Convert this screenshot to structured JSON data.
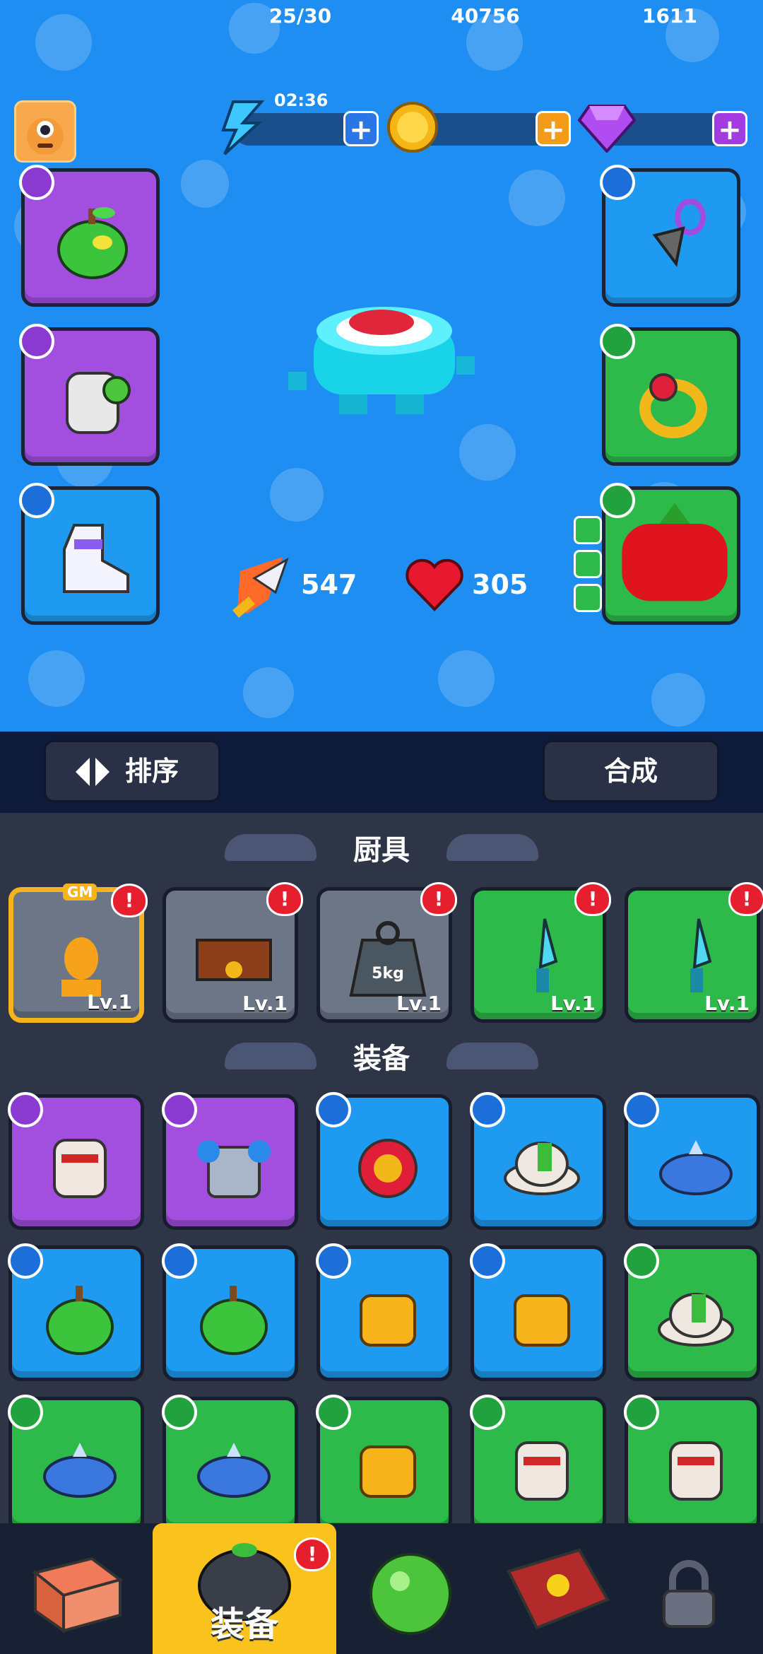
{
  "header": {
    "energy": "25/30",
    "energy_timer": "02:36",
    "coins": "40756",
    "gems": "1611",
    "plus": "+"
  },
  "hero": {
    "attack": "547",
    "health": "305"
  },
  "equipped_slots": [
    {
      "name": "helmet",
      "color": "purple",
      "item": "green-apple-helmet-icon"
    },
    {
      "name": "armor",
      "color": "purple",
      "item": "grey-armor-icon"
    },
    {
      "name": "boots",
      "color": "blue",
      "item": "boots-icon"
    },
    {
      "name": "necklace",
      "color": "blue",
      "item": "pendant-icon"
    },
    {
      "name": "ring",
      "color": "green",
      "item": "ruby-ring-icon"
    },
    {
      "name": "pet",
      "color": "green",
      "item": "tomato-pet-icon"
    }
  ],
  "toolbar": {
    "sort_label": "排序",
    "merge_label": "合成"
  },
  "sections": {
    "kitchenware": "厨具",
    "equipment": "装备"
  },
  "kitchenware": [
    {
      "item": "golden-statue-icon",
      "level": "Lv.1",
      "rarity": "gold",
      "tag": "GM"
    },
    {
      "item": "chest-icon",
      "level": "Lv.1",
      "rarity": "gray"
    },
    {
      "item": "weight-icon",
      "level": "Lv.1",
      "rarity": "gray",
      "weight_label": "5kg"
    },
    {
      "item": "knife-icon",
      "level": "Lv.1",
      "rarity": "green"
    },
    {
      "item": "knife-icon",
      "level": "Lv.1",
      "rarity": "green"
    }
  ],
  "equipment": [
    {
      "item": "chef-armor-icon",
      "rarity": "purple",
      "slot": "armor"
    },
    {
      "item": "barrel-armor-icon",
      "rarity": "purple",
      "slot": "armor"
    },
    {
      "item": "crown-helmet-icon",
      "rarity": "blue",
      "slot": "helmet"
    },
    {
      "item": "green-cap-icon",
      "rarity": "blue",
      "slot": "helmet"
    },
    {
      "item": "spiked-helmet-icon",
      "rarity": "blue",
      "slot": "helmet"
    },
    {
      "item": "apple-helmet-icon",
      "rarity": "blue",
      "slot": "helmet"
    },
    {
      "item": "apple-helmet-icon",
      "rarity": "blue",
      "slot": "helmet"
    },
    {
      "item": "gold-armor-icon",
      "rarity": "blue",
      "slot": "armor"
    },
    {
      "item": "gold-armor-icon",
      "rarity": "blue",
      "slot": "armor"
    },
    {
      "item": "green-cap-icon",
      "rarity": "green",
      "slot": "helmet"
    },
    {
      "item": "spiked-helmet-icon",
      "rarity": "green",
      "slot": "helmet"
    },
    {
      "item": "spiked-helmet-icon",
      "rarity": "green",
      "slot": "helmet"
    },
    {
      "item": "gold-armor-icon",
      "rarity": "green",
      "slot": "armor"
    },
    {
      "item": "chef-armor-icon",
      "rarity": "green",
      "slot": "armor"
    },
    {
      "item": "chef-armor-icon",
      "rarity": "green",
      "slot": "armor"
    }
  ],
  "nav": {
    "tabs": [
      {
        "name": "shop",
        "icon": "shop-box-icon",
        "label": ""
      },
      {
        "name": "equipment",
        "icon": "helmet-icon",
        "label": "装备",
        "active": true
      },
      {
        "name": "skills",
        "icon": "green-orb-icon",
        "label": ""
      },
      {
        "name": "book",
        "icon": "book-icon",
        "label": ""
      },
      {
        "name": "locked",
        "icon": "lock-icon",
        "label": ""
      }
    ],
    "alert_mark": "!"
  },
  "colors": {
    "sky": "#1f8ef2",
    "purple": "#a24fe0",
    "blue": "#1e9bf0",
    "green": "#2dba4a",
    "gold": "#f6b31b",
    "alert": "#e51f2e"
  }
}
